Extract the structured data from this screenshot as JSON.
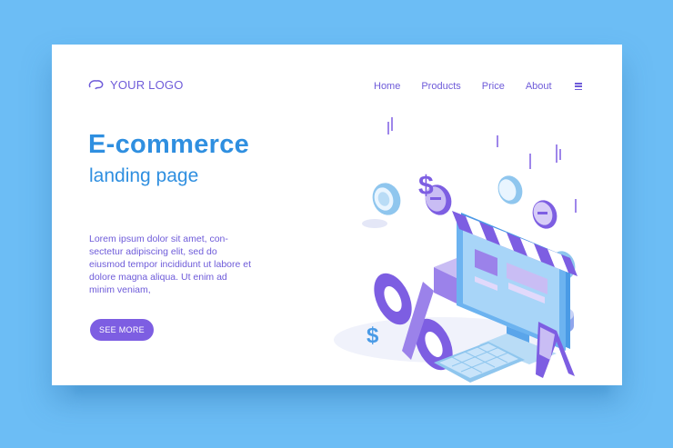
{
  "header": {
    "logo_text": "YOUR LOGO",
    "nav": [
      "Home",
      "Products",
      "Price",
      "About"
    ]
  },
  "hero": {
    "title": "E-commerce",
    "subtitle": "landing page",
    "body": "Lorem ipsum dolor sit amet, con-sectetur adipiscing elit, sed do eiusmod tempor incididunt ut labore et dolore magna aliqua. Ut enim ad minim veniam,",
    "cta_label": "SEE MORE"
  },
  "illustration": {
    "dollar_symbol": "$",
    "percent_symbol": "%"
  },
  "colors": {
    "background": "#6cbdf5",
    "card": "#ffffff",
    "accent_purple": "#7d5ee2",
    "accent_blue": "#2f8fe0"
  }
}
